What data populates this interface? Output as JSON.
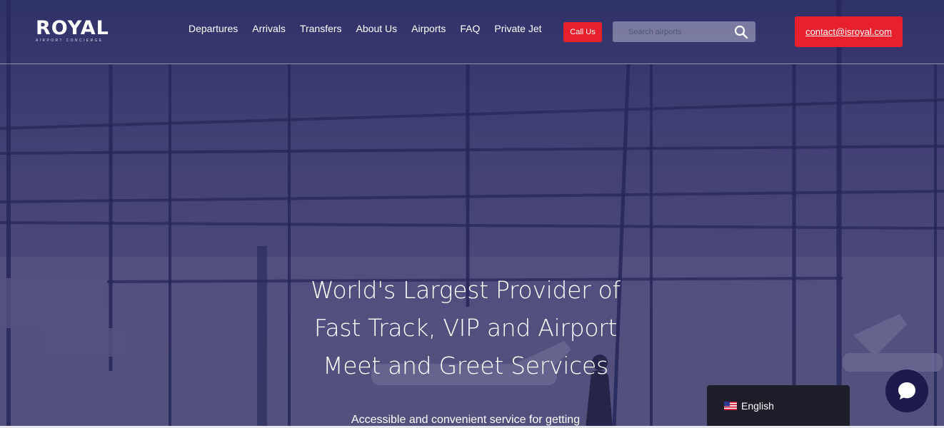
{
  "brand": {
    "logo_text": "ROYAL",
    "logo_subtext": "AIRPORT CONCIERGE"
  },
  "nav": {
    "items": [
      {
        "label": "Departures"
      },
      {
        "label": "Arrivals"
      },
      {
        "label": "Transfers"
      },
      {
        "label": "About Us"
      },
      {
        "label": "Airports"
      },
      {
        "label": "FAQ"
      },
      {
        "label": "Private Jet"
      }
    ],
    "call_label": "Call Us",
    "search_placeholder": "Search airports",
    "contact_label": "contact@isroyal.com"
  },
  "hero": {
    "headline": "World's Largest Provider of Fast Track, VIP and Airport Meet and Greet Services",
    "subline": "Accessible and convenient service for getting"
  },
  "language": {
    "label": "English",
    "flag_icon": "us-flag-icon"
  },
  "chat": {
    "icon": "chat-bubble-icon"
  },
  "colors": {
    "accent": "#e8202e",
    "overlay": "#403f73",
    "language_bg": "#1e1e2a",
    "chat_bg": "#1d1b4d"
  }
}
